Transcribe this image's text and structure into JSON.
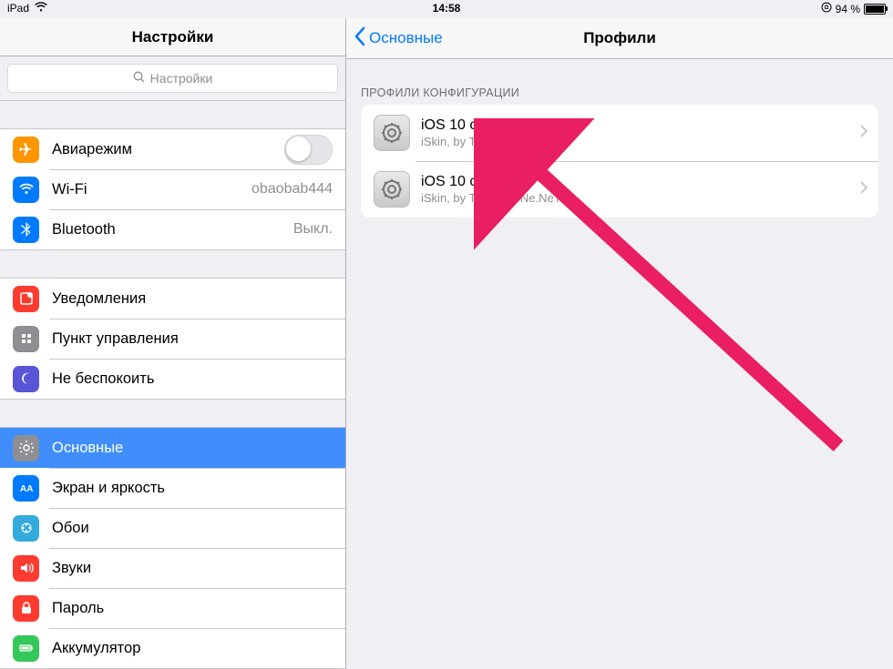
{
  "statusbar": {
    "device": "iPad",
    "time": "14:58",
    "battery_pct": "94 %"
  },
  "sidebar": {
    "title": "Настройки",
    "search_placeholder": "Настройки",
    "airplane": {
      "label": "Авиарежим"
    },
    "wifi": {
      "label": "Wi-Fi",
      "value": "obaobab444"
    },
    "bluetooth": {
      "label": "Bluetooth",
      "value": "Выкл."
    },
    "notifications": {
      "label": "Уведомления"
    },
    "control_center": {
      "label": "Пункт управления"
    },
    "dnd": {
      "label": "Не беспокоить"
    },
    "general": {
      "label": "Основные"
    },
    "display": {
      "label": "Экран и яркость"
    },
    "wallpaper": {
      "label": "Обои"
    },
    "sounds": {
      "label": "Звуки"
    },
    "passcode": {
      "label": "Пароль"
    },
    "battery": {
      "label": "Аккумулятор"
    }
  },
  "detail": {
    "back_label": "Основные",
    "title": "Профили",
    "section_header": "ПРОФИЛИ КОНФИГУРАЦИИ",
    "profiles": [
      {
        "title": "iOS 10 concepts",
        "subtitle": "iSkin, by TooLiPHoNe.NeT"
      },
      {
        "title": "iOS 10 concepts",
        "subtitle": "iSkin, by TooLiPHoNe.NeT"
      }
    ]
  }
}
